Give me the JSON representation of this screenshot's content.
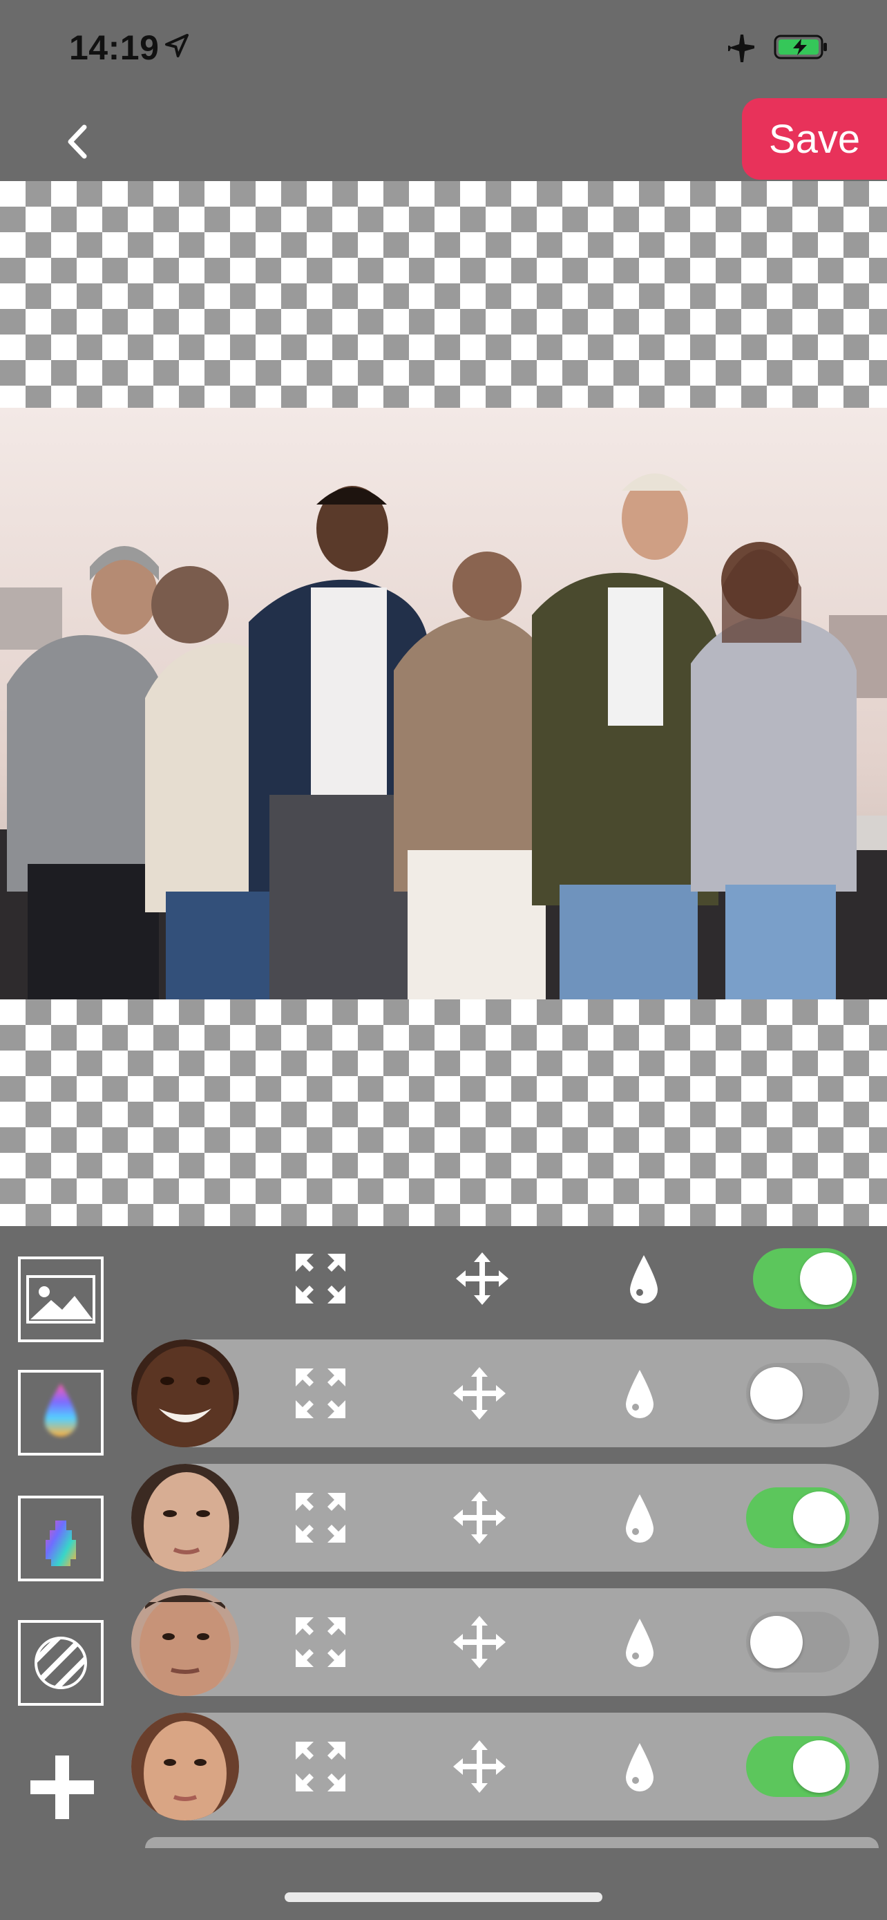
{
  "status_bar": {
    "time": "14:19"
  },
  "header": {
    "save_label": "Save"
  },
  "toolbar": {
    "layers": [
      {
        "name": "background",
        "enabled": true
      },
      {
        "name": "face-1",
        "enabled": false
      },
      {
        "name": "face-2",
        "enabled": true
      },
      {
        "name": "face-3",
        "enabled": false
      },
      {
        "name": "face-4",
        "enabled": true
      }
    ]
  },
  "colors": {
    "accent": "#e8325a",
    "toggle_on": "#5cc65c",
    "panel_bg": "#6b6b6b",
    "row_bg": "#a6a6a6"
  }
}
